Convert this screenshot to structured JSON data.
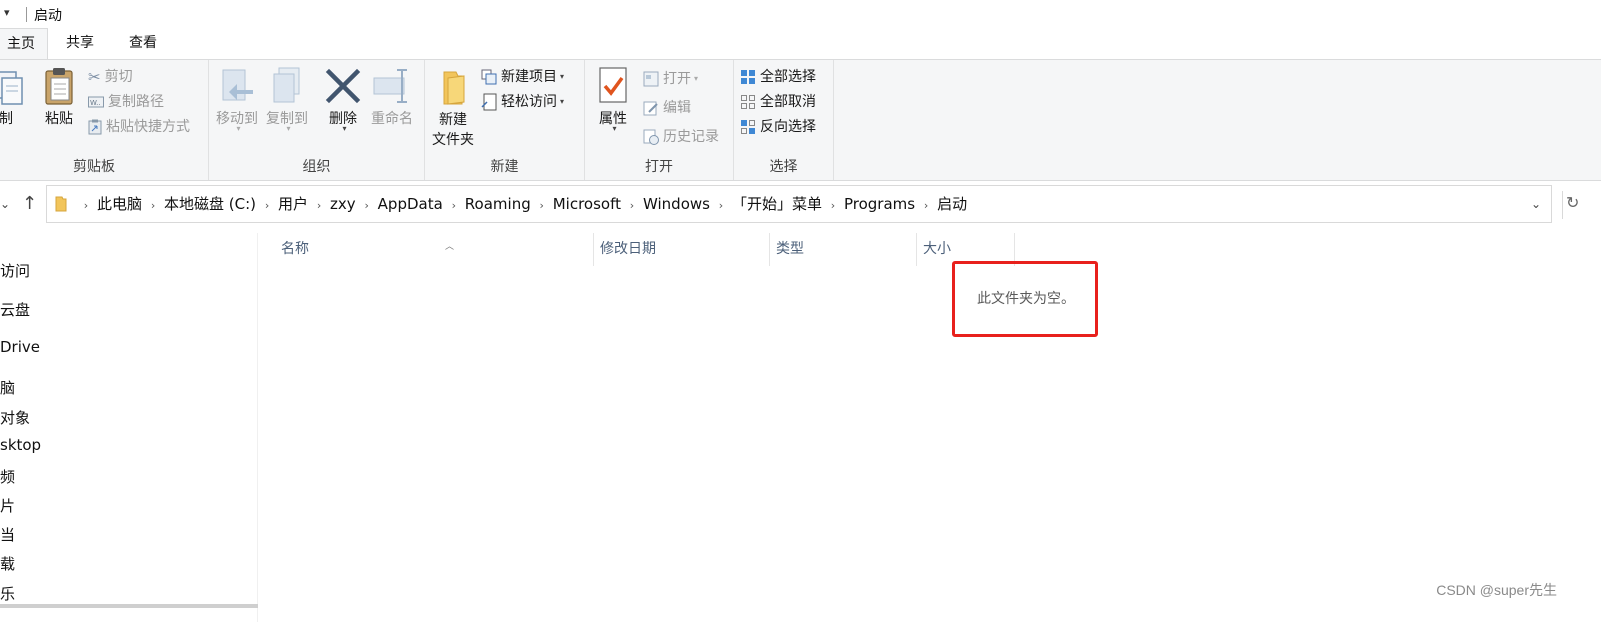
{
  "window": {
    "title": "启动"
  },
  "tabs": {
    "home": "主页",
    "share": "共享",
    "view": "查看"
  },
  "ribbon": {
    "clipboard": {
      "label": "剪贴板",
      "copy": "复制",
      "paste": "粘贴",
      "cut": "剪切",
      "copy_path": "复制路径",
      "paste_shortcut": "粘贴快捷方式"
    },
    "organize": {
      "label": "组织",
      "move_to": "移动到",
      "copy_to": "复制到",
      "delete": "删除",
      "rename": "重命名"
    },
    "new": {
      "label": "新建",
      "new_folder": "新建\n文件夹",
      "new_item": "新建项目",
      "easy_access": "轻松访问"
    },
    "open": {
      "label": "打开",
      "properties": "属性",
      "open": "打开",
      "edit": "编辑",
      "history": "历史记录"
    },
    "select": {
      "label": "选择",
      "select_all": "全部选择",
      "select_none": "全部取消",
      "invert": "反向选择"
    }
  },
  "address": {
    "crumbs": [
      "此电脑",
      "本地磁盘 (C:)",
      "用户",
      "zxy",
      "AppData",
      "Roaming",
      "Microsoft",
      "Windows",
      "「开始」菜单",
      "Programs",
      "启动"
    ]
  },
  "navpane": {
    "items": [
      "访问",
      "云盘",
      "Drive",
      "脑",
      "对象",
      "sktop",
      "频",
      "片",
      "当",
      "载",
      "乐"
    ]
  },
  "filelist": {
    "columns": [
      "名称",
      "修改日期",
      "类型",
      "大小"
    ],
    "empty_message": "此文件夹为空。"
  },
  "watermark": "CSDN @super先生",
  "colors": {
    "highlight": "#e8201c",
    "header_text": "#4c607a",
    "ribbon_bg": "#f5f6f7"
  }
}
